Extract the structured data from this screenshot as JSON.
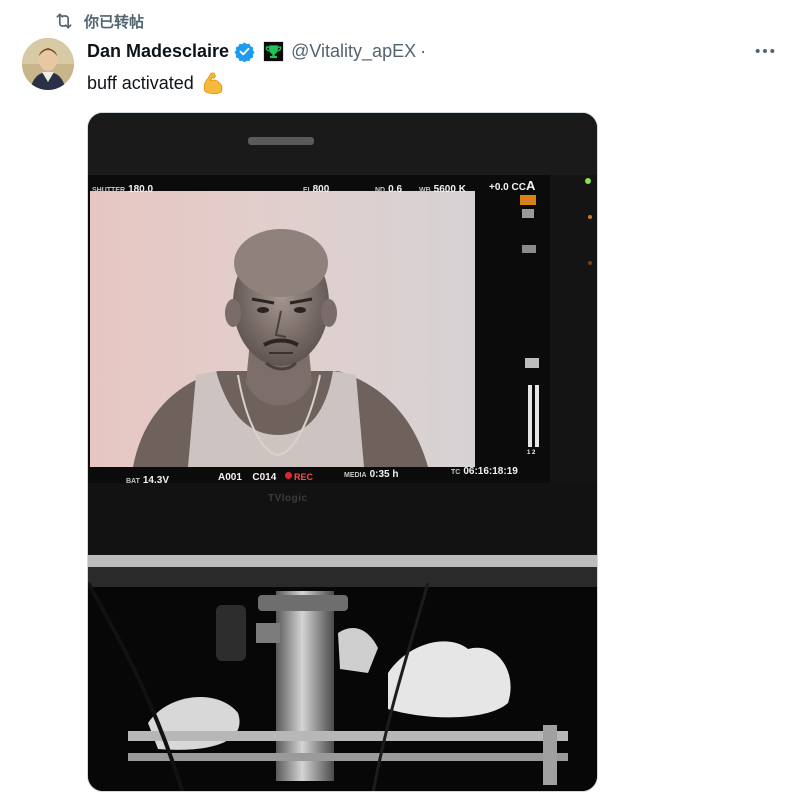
{
  "repost": {
    "label": "你已转帖",
    "icon": "repost-icon"
  },
  "author": {
    "display_name": "Dan Madesclaire",
    "handle": "@Vitality_apEX",
    "separator": "·",
    "verified": true,
    "verified_color": "#1d9bf0",
    "badge": "trophy-badge-icon"
  },
  "tweet": {
    "text": "buff activated",
    "emoji": "flexed-biceps-icon"
  },
  "more": {
    "icon": "more-icon"
  },
  "monitor": {
    "shutter_label": "SHUTTER",
    "shutter_value": "180.0",
    "ei_label": "EI",
    "ei_value": "800",
    "nd_label": "ND",
    "nd_value": "0.6",
    "wb_label": "WB",
    "wb_value": "5600 K",
    "cc_value": "+0.0 CC",
    "cc_suffix": "A",
    "bat_label": "BAT",
    "bat_value": "14.3V",
    "reel": "A001",
    "clip": "C014",
    "rec": "REC",
    "media_label": "MEDIA",
    "media_value": "0:35 h",
    "tc_label": "TC",
    "tc_value": "06:16:18:19",
    "brand": "TVlogic",
    "meter_labels": "1 2"
  },
  "colors": {
    "text_primary": "#0f1419",
    "text_secondary": "#536471",
    "accent": "#1d9bf0",
    "rec": "#e0242e"
  }
}
